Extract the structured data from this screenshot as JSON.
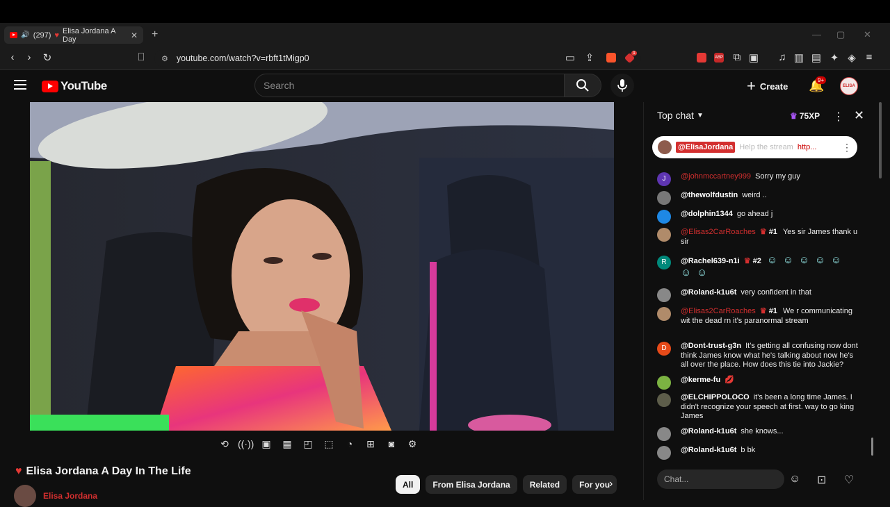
{
  "browser": {
    "tab": {
      "count": "(297)",
      "title": "Elisa Jordana A Day",
      "close": "✕"
    },
    "new_tab": "+",
    "window_controls": {
      "minimize": "—",
      "maximize": "▢",
      "close": "✕"
    },
    "url": "youtube.com/watch?v=rbft1tMigp0",
    "brave_shield_count": "",
    "rewards_count": "1"
  },
  "youtube": {
    "logo_text": "YouTube",
    "search_placeholder": "Search",
    "create_label": "Create",
    "notification_badge": "9+",
    "avatar_text": "ELISA"
  },
  "video": {
    "title": "Elisa Jordana A Day In The Life",
    "channel": "Elisa Jordana"
  },
  "chips": [
    {
      "label": "All",
      "active": true
    },
    {
      "label": "From Elisa Jordana"
    },
    {
      "label": "Related"
    },
    {
      "label": "For you"
    }
  ],
  "chat": {
    "header": "Top chat",
    "xp": "75XP",
    "pinned": {
      "author": "@ElisaJordana",
      "text": "Help the stream",
      "link": "http..."
    },
    "input_placeholder": "Chat...",
    "messages": [
      {
        "initial": "J",
        "avatar_color": "#5e35b1",
        "author": "@johnmccartney999",
        "author_style": "red",
        "text": "Sorry my guy"
      },
      {
        "initial": "",
        "avatar_color": "#777777",
        "author": "@thewolfdustin",
        "text": "weird .."
      },
      {
        "initial": "",
        "avatar_color": "#1e88e5",
        "author": "@dolphin1344",
        "text": "go ahead j"
      },
      {
        "initial": "",
        "avatar_color": "#b08b6a",
        "author": "@Elisas2CarRoaches",
        "author_style": "red",
        "rank": "#1",
        "text": "Yes sir James thank u sir"
      },
      {
        "initial": "R",
        "avatar_color": "#00897b",
        "author": "@Rachel639-n1i",
        "rank": "#2",
        "text": "",
        "emotes": 7
      },
      {
        "initial": "",
        "avatar_color": "#888888",
        "author": "@Roland-k1u6t",
        "text": "very confident in that"
      },
      {
        "initial": "",
        "avatar_color": "#b08b6a",
        "author": "@Elisas2CarRoaches",
        "author_style": "red",
        "rank": "#1",
        "text": "We r communicating wit the dead rn it's paranormal stream"
      },
      {
        "initial": "D",
        "avatar_color": "#e64a19",
        "author": "@Dont-trust-g3n",
        "text": "It's getting all confusing now dont think James know what he's talking about now he's all over the place. How does this tie into Jackie?"
      },
      {
        "initial": "",
        "avatar_color": "#7cb342",
        "author": "@kerme-fu",
        "text": "",
        "emote_lips": true
      },
      {
        "initial": "",
        "avatar_color": "#5d5d4a",
        "author": "@ELCHIPPOLOCO",
        "text": "it's been a long time James. I didn't recognize your speech at first. way to go king James"
      },
      {
        "initial": "",
        "avatar_color": "#888888",
        "author": "@Roland-k1u6t",
        "text": "she knows..."
      },
      {
        "initial": "",
        "avatar_color": "#888888",
        "author": "@Roland-k1u6t",
        "text": "b bk"
      }
    ]
  },
  "colors": {
    "accent": "#ff0000",
    "background": "#0f0f0f",
    "chip_bg": "#272727"
  }
}
